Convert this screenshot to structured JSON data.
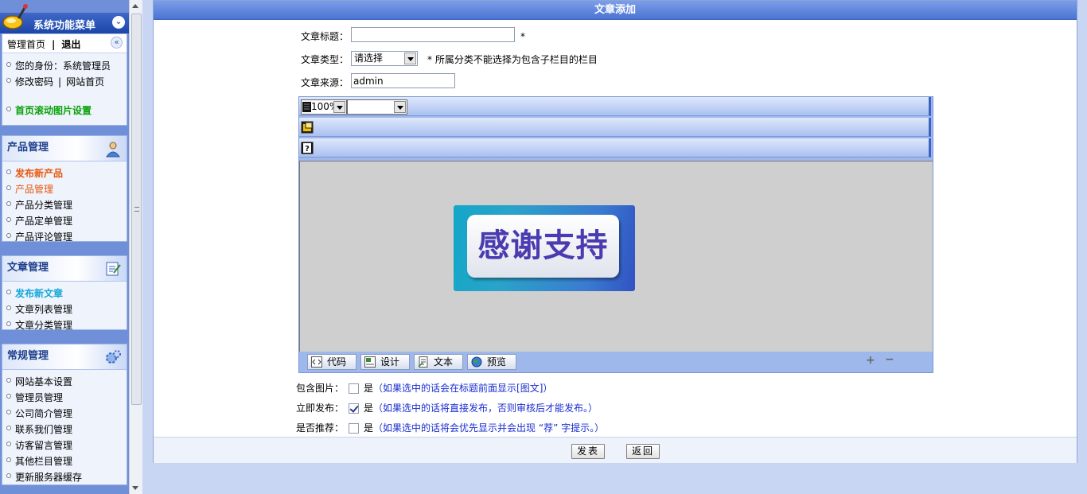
{
  "sidebar": {
    "menu_title": "系统功能菜单",
    "top": {
      "home": "管理首页",
      "separator": "|",
      "logout": "退出",
      "identity": "您的身份：系统管理员",
      "change_password": "修改密码",
      "pipe": "|",
      "website_home": "网站首页",
      "slider_settings": "首页滚动图片设置"
    },
    "product": {
      "title": "产品管理",
      "items": [
        "发布新产品",
        "产品管理",
        "产品分类管理",
        "产品定单管理",
        "产品评论管理"
      ]
    },
    "article": {
      "title": "文章管理",
      "items": [
        "发布新文章",
        "文章列表管理",
        "文章分类管理"
      ]
    },
    "general": {
      "title": "常规管理",
      "items": [
        "网站基本设置",
        "管理员管理",
        "公司简介管理",
        "联系我们管理",
        "访客留言管理",
        "其他栏目管理",
        "更新服务器缓存"
      ]
    }
  },
  "panel": {
    "title": "文章添加",
    "article_title_label": "文章标题：",
    "article_title_value": "",
    "required_mark": "*",
    "article_type_label": "文章类型：",
    "article_type_selected": "请选择",
    "article_type_note": "* 所属分类不能选择为包含子栏目的栏目",
    "source_label": "文章来源：",
    "source_value": "admin",
    "editor": {
      "zoom": "100%",
      "image_text": "感谢支持",
      "tabs": [
        "代码",
        "设计",
        "文本",
        "预览"
      ],
      "plus": "+",
      "minus": "−"
    },
    "options": [
      {
        "label": "包含图片：",
        "checked": false,
        "yes": "是",
        "hint": "（如果选中的话会在标题前面显示[图文]）"
      },
      {
        "label": "立即发布：",
        "checked": true,
        "yes": "是",
        "hint": "（如果选中的话将直接发布，否则审核后才能发布。）"
      },
      {
        "label": "是否推荐：",
        "checked": false,
        "yes": "是",
        "hint": "（如果选中的话将会优先显示并会出现 “荐” 字提示。）"
      }
    ],
    "submit": "发表",
    "back": "返回"
  },
  "colors": {
    "accent": "#4a74d3",
    "sidebar_bg": "#6f8fd8",
    "hint": "#1a2dd0",
    "highlight_orange": "#e8590c",
    "highlight_cyan": "#13a7d8",
    "highlight_green": "#0aa20a"
  }
}
